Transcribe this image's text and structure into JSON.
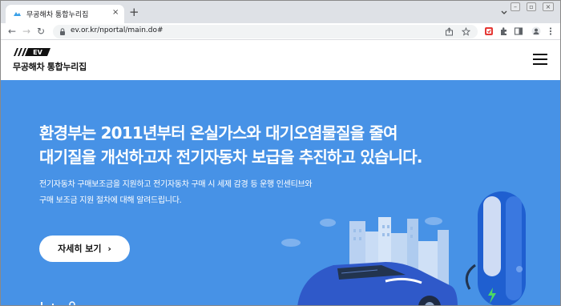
{
  "browser": {
    "tab_title": "무공해차 통합누리집",
    "close_glyph": "×",
    "new_tab_glyph": "+",
    "url": "ev.or.kr/nportal/main.do#",
    "back_glyph": "←",
    "forward_glyph": "→",
    "reload_glyph": "↻"
  },
  "site": {
    "logo_badge": "EV",
    "name": "무공해차 통합누리집"
  },
  "hero": {
    "title_line1": "환경부는 2011년부터 온실가스와 대기오염물질을 줄여",
    "title_line2": "대기질을 개선하고자 전기자동차 보급을 추진하고 있습니다.",
    "desc_line1": "전기자동차 구매보조금을 지원하고 전기자동차 구매 시 세제 감경 등 운행 인센티브와",
    "desc_line2": "구매 보조금 지원 절차에 대해 알려드립니다.",
    "button_label": "자세히 보기",
    "button_arrow": "›"
  },
  "colors": {
    "hero_bg": "#4792e6",
    "tab_strip": "#dee1e6"
  }
}
